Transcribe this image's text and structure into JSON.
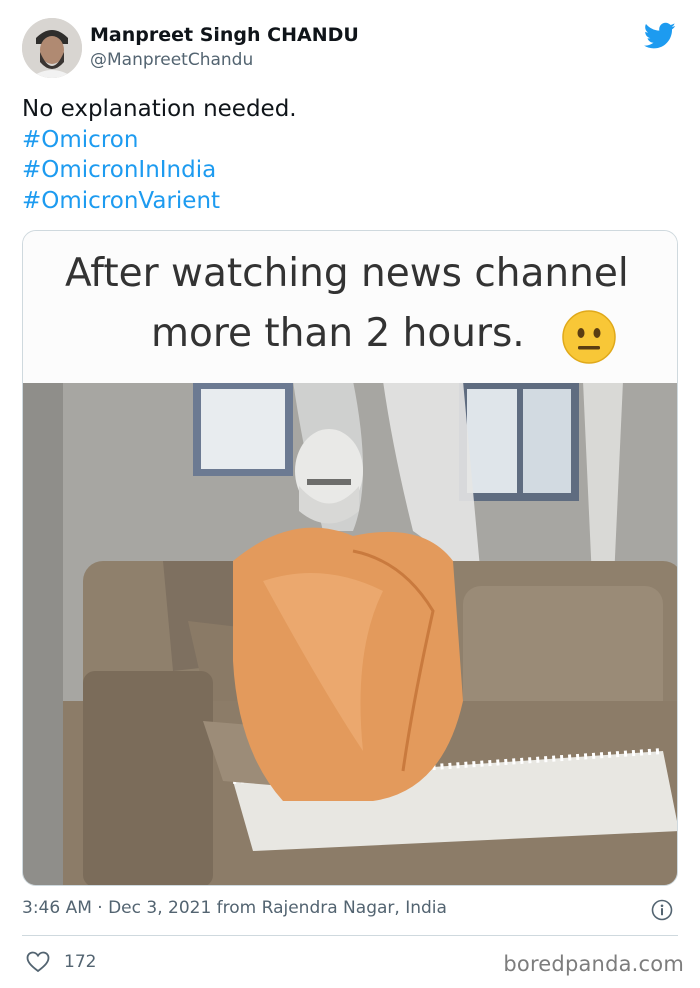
{
  "author": {
    "name": "Manpreet Singh CHANDU",
    "handle": "@ManpreetChandu"
  },
  "tweet": {
    "text": "No explanation needed.",
    "hashtags": [
      "#Omicron",
      "#OmicronInIndia",
      "#OmicronVarient"
    ]
  },
  "media": {
    "caption_line1": "After watching news channel",
    "caption_line2": "more than 2 hours.",
    "emoji": "neutral-face"
  },
  "meta": {
    "timestamp": "3:46 AM · Dec 3, 2021 from Rajendra Nagar, India"
  },
  "engagement": {
    "likes": "172"
  },
  "watermark": "boredpanda.com",
  "colors": {
    "link": "#1d9bf0",
    "text": "#0f1419",
    "secondary": "#536471",
    "twitter_blue": "#1d9bf0"
  },
  "icons": {
    "brand": "twitter-bird-icon",
    "info": "info-icon",
    "like": "heart-icon"
  }
}
